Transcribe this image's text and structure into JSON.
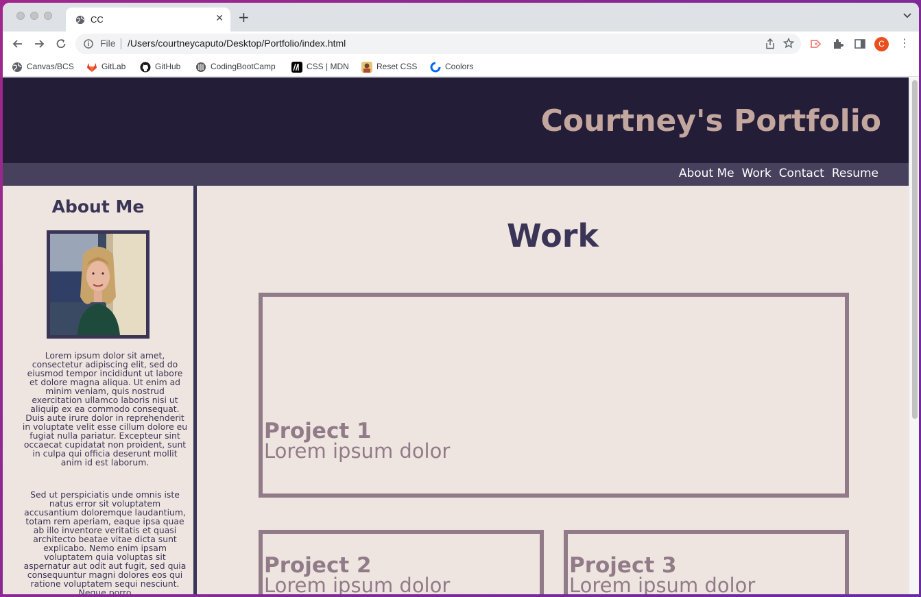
{
  "browser": {
    "tab_title": "CC",
    "address_scheme": "File",
    "address_url": "/Users/courtneycaputo/Desktop/Portfolio/index.html",
    "profile_initial": "C",
    "bookmarks": [
      {
        "label": "Canvas/BCS",
        "icon": "globe-icon"
      },
      {
        "label": "GitLab",
        "icon": "gitlab-icon"
      },
      {
        "label": "GitHub",
        "icon": "github-icon"
      },
      {
        "label": "CodingBootCamp",
        "icon": "bootcamp-icon"
      },
      {
        "label": "CSS | MDN",
        "icon": "mdn-icon"
      },
      {
        "label": "Reset CSS",
        "icon": "reset-css-icon"
      },
      {
        "label": "Coolors",
        "icon": "coolors-icon"
      }
    ]
  },
  "site": {
    "title": "Courtney's Portfolio",
    "nav": [
      "About Me",
      "Work",
      "Contact",
      "Resume"
    ],
    "colors": {
      "header": "#231d38",
      "nav": "#47415e",
      "background": "#efe5e0",
      "title": "#c3a79f",
      "accent": "#3a3556",
      "project": "#917b88"
    }
  },
  "aside": {
    "title": "About Me",
    "paragraph1": "Lorem ipsum dolor sit amet, consectetur adipiscing elit, sed do eiusmod tempor incididunt ut labore et dolore magna aliqua. Ut enim ad minim veniam, quis nostrud exercitation ullamco laboris nisi ut aliquip ex ea commodo consequat. Duis aute irure dolor in reprehenderit in voluptate velit esse cillum dolore eu fugiat nulla pariatur. Excepteur sint occaecat cupidatat non proident, sunt in culpa qui officia deserunt mollit anim id est laborum.",
    "paragraph2": "Sed ut perspiciatis unde omnis iste natus error sit voluptatem accusantium doloremque laudantium, totam rem aperiam, eaque ipsa quae ab illo inventore veritatis et quasi architecto beatae vitae dicta sunt explicabo. Nemo enim ipsam voluptatem quia voluptas sit aspernatur aut odit aut fugit, sed quia consequuntur magni dolores eos qui ratione voluptatem sequi nesciunt. Neque porro"
  },
  "work": {
    "title": "Work",
    "projects": [
      {
        "name": "Project 1",
        "description": "Lorem ipsum dolor"
      },
      {
        "name": "Project 2",
        "description": "Lorem ipsum dolor"
      },
      {
        "name": "Project 3",
        "description": "Lorem ipsum dolor"
      }
    ]
  }
}
